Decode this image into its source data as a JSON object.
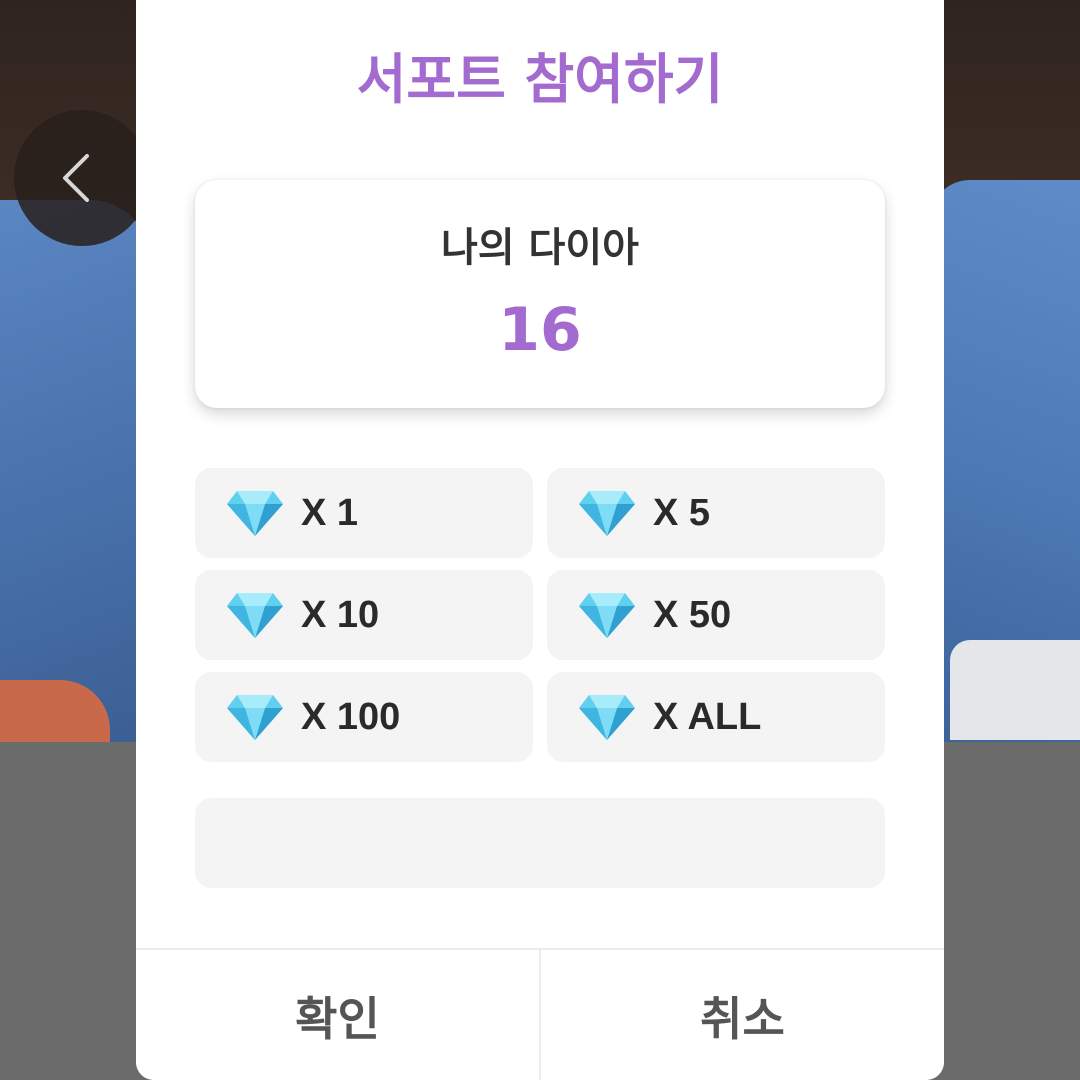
{
  "dialog": {
    "title": "서포트 참여하기",
    "balance": {
      "label": "나의 다이아",
      "value": "16"
    },
    "amount_options": [
      {
        "label": "X 1",
        "icon": "diamond-icon"
      },
      {
        "label": "X 5",
        "icon": "diamond-icon"
      },
      {
        "label": "X 10",
        "icon": "diamond-icon"
      },
      {
        "label": "X 50",
        "icon": "diamond-icon"
      },
      {
        "label": "X 100",
        "icon": "diamond-icon"
      },
      {
        "label": "X ALL",
        "icon": "diamond-icon"
      }
    ],
    "message_input": {
      "value": ""
    },
    "confirm_label": "확인",
    "cancel_label": "취소"
  },
  "background": {
    "back_icon": "chevron-left-icon"
  },
  "colors": {
    "accent": "#a36bcf",
    "option_bg": "#f4f4f4",
    "overlay": "#6b6b6b"
  }
}
